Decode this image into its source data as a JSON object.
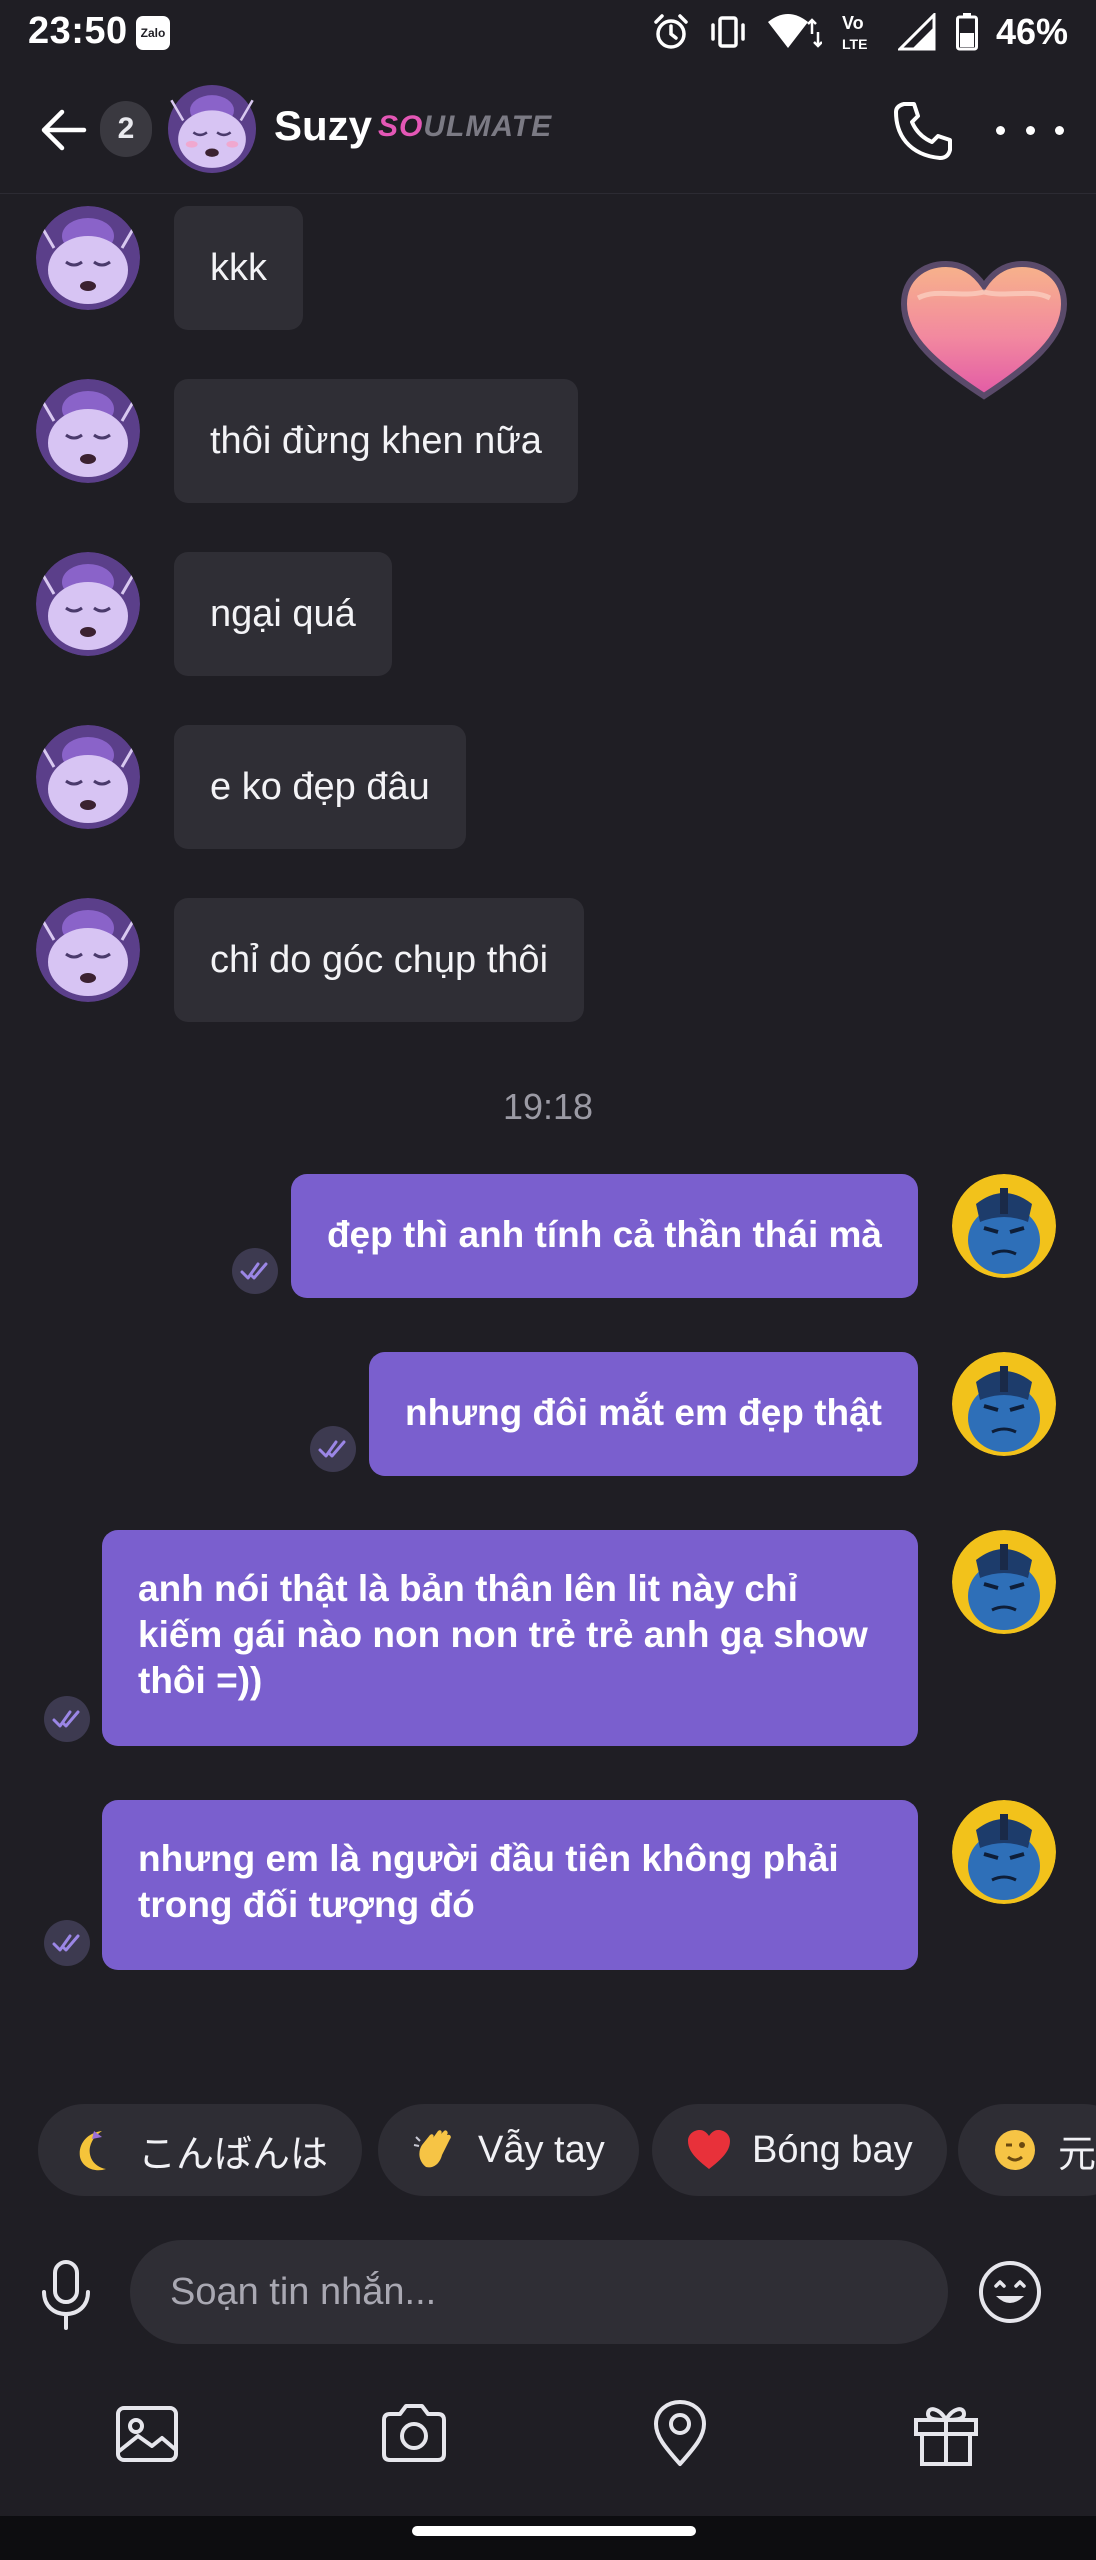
{
  "status_bar": {
    "time": "23:50",
    "notification_app": "Zalo",
    "network_label": "Vo LTE",
    "battery": "46%"
  },
  "header": {
    "unread_count": "2",
    "contact_name": "Suzy",
    "badge_prefix": "SO",
    "badge_suffix": "ULMATE"
  },
  "incoming_messages": [
    "kkk",
    "thôi đừng khen nữa",
    "ngại quá",
    "e ko đẹp đâu",
    "chỉ do góc chụp thôi"
  ],
  "timestamp": "19:18",
  "outgoing_messages": [
    "đẹp thì anh tính cả thần thái mà",
    "nhưng đôi mắt em đẹp thật",
    "anh nói thật là bản thân lên lit này chỉ kiếm gái nào non non trẻ trẻ anh gạ show thôi =))",
    "nhưng em là người đầu tiên không phải trong đối tượng đó"
  ],
  "quick_replies": [
    {
      "icon": "crescent-moon-icon",
      "label": "こんばんは"
    },
    {
      "icon": "waving-hand-icon",
      "label": "Vẫy tay"
    },
    {
      "icon": "red-heart-icon",
      "label": "Bóng bay"
    },
    {
      "icon": "winking-face-icon",
      "label": "元"
    }
  ],
  "composer": {
    "placeholder": "Soạn tin nhắn..."
  },
  "toolbar": {
    "items": [
      "image-icon",
      "camera-icon",
      "location-pin-icon",
      "gift-icon"
    ]
  },
  "colors": {
    "background": "#1f1e24",
    "incoming_bubble": "#2f2e35",
    "outgoing_bubble": "#7a5fce",
    "accent_pink": "#e457b6"
  }
}
